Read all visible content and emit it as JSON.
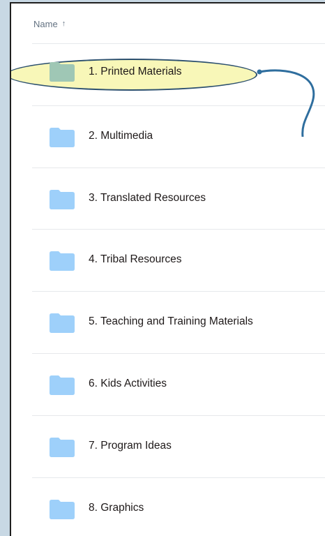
{
  "header": {
    "name_label": "Name",
    "sort_icon": "arrow-up-icon"
  },
  "folders": [
    {
      "label": "1. Printed Materials",
      "highlighted": true,
      "folder_color": "#9fc7b5"
    },
    {
      "label": "2. Multimedia",
      "folder_color": "#9ed0fa"
    },
    {
      "label": "3. Translated Resources",
      "folder_color": "#9ed0fa"
    },
    {
      "label": "4. Tribal Resources",
      "folder_color": "#9ed0fa"
    },
    {
      "label": "5. Teaching and Training Materials",
      "folder_color": "#9ed0fa"
    },
    {
      "label": "6. Kids Activities",
      "folder_color": "#9ed0fa"
    },
    {
      "label": "7. Program Ideas",
      "folder_color": "#9ed0fa"
    },
    {
      "label": "8. Graphics",
      "folder_color": "#9ed0fa"
    }
  ],
  "colors": {
    "background": "#c8d8e4",
    "highlight_fill": "#f8f7b8",
    "highlight_outline": "#2b4f6e",
    "callout_line": "#2f6e9e"
  }
}
